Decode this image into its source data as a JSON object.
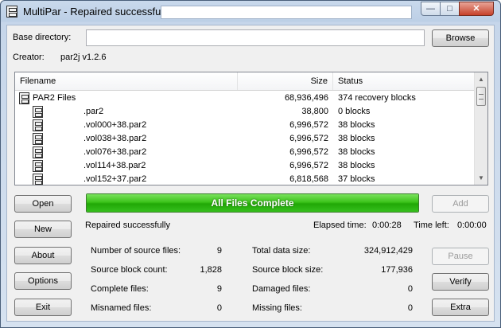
{
  "window": {
    "title": "MultiPar - Repaired successfully"
  },
  "base_directory": {
    "label": "Base directory:",
    "value": ""
  },
  "browse_label": "Browse",
  "creator": {
    "label": "Creator:",
    "value": "par2j v1.2.6"
  },
  "list": {
    "columns": [
      "Filename",
      "Size",
      "Status"
    ],
    "group": {
      "name": "PAR2 Files",
      "size": "68,936,496",
      "status": "374 recovery blocks"
    },
    "rows": [
      {
        "name": ".par2",
        "size": "38,800",
        "status": "0 blocks"
      },
      {
        "name": ".vol000+38.par2",
        "size": "6,996,572",
        "status": "38 blocks"
      },
      {
        "name": ".vol038+38.par2",
        "size": "6,996,572",
        "status": "38 blocks"
      },
      {
        "name": ".vol076+38.par2",
        "size": "6,996,572",
        "status": "38 blocks"
      },
      {
        "name": ".vol114+38.par2",
        "size": "6,996,572",
        "status": "38 blocks"
      },
      {
        "name": ".vol152+37.par2",
        "size": "6,818,568",
        "status": "37 blocks"
      }
    ]
  },
  "progress": {
    "text": "All Files Complete",
    "fraction": 1.0,
    "color": "#2db814"
  },
  "status_text": "Repaired successfully",
  "elapsed": {
    "label": "Elapsed time:",
    "value": "0:00:28"
  },
  "time_left": {
    "label": "Time left:",
    "value": "0:00:00"
  },
  "buttons": {
    "open": "Open",
    "new": "New",
    "about": "About",
    "options": "Options",
    "exit": "Exit",
    "add": "Add",
    "pause": "Pause",
    "verify": "Verify",
    "extra": "Extra"
  },
  "stats": {
    "source_files": {
      "label": "Number of source files:",
      "value": "9"
    },
    "block_count": {
      "label": "Source block count:",
      "value": "1,828"
    },
    "complete_files": {
      "label": "Complete files:",
      "value": "9"
    },
    "misnamed_files": {
      "label": "Misnamed files:",
      "value": "0"
    },
    "total_size": {
      "label": "Total data size:",
      "value": "324,912,429"
    },
    "block_size": {
      "label": "Source block size:",
      "value": "177,936"
    },
    "damaged_files": {
      "label": "Damaged files:",
      "value": "0"
    },
    "missing_files": {
      "label": "Missing files:",
      "value": "0"
    }
  },
  "icons": {
    "app": "multipar-app-icon",
    "file": "par2-file-icon"
  }
}
